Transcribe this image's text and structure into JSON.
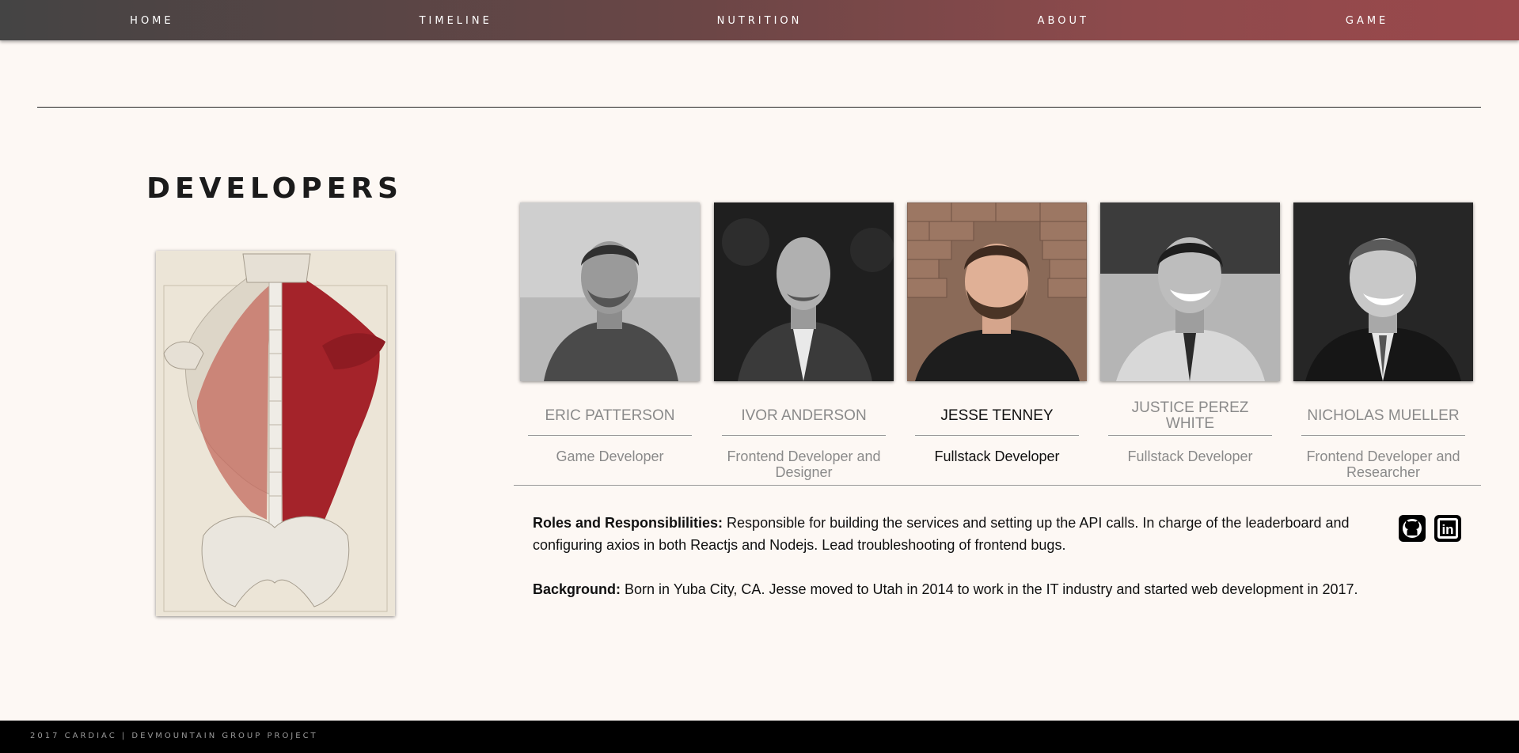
{
  "nav": {
    "items": [
      "HOME",
      "TIMELINE",
      "NUTRITION",
      "ABOUT",
      "GAME"
    ]
  },
  "page": {
    "title": "DEVELOPERS"
  },
  "developers": [
    {
      "name": "ERIC PATTERSON",
      "role": "Game Developer",
      "active": false
    },
    {
      "name": "IVOR ANDERSON",
      "role": "Frontend Developer and Designer",
      "active": false
    },
    {
      "name": "JESSE TENNEY",
      "role": "Fullstack Developer",
      "active": true
    },
    {
      "name": "JUSTICE PEREZ WHITE",
      "role": "Fullstack Developer",
      "active": false
    },
    {
      "name": "NICHOLAS MUELLER",
      "role": "Frontend Developer and Researcher",
      "active": false
    }
  ],
  "bio": {
    "roles_label": "Roles and Responsiblilities:",
    "roles_text": " Responsible for building the services and setting up the API calls. In charge of the leaderboard and configuring axios in both Reactjs and Nodejs. Lead troubleshooting of frontend bugs.",
    "background_label": "Background:",
    "background_text": " Born in Yuba City, CA. Jesse moved to Utah in 2014 to work in the IT industry and started web development in 2017."
  },
  "social": {
    "github_icon": "github-icon",
    "linkedin_icon": "linkedin-icon",
    "linkedin_glyph": "in"
  },
  "footer": {
    "text": "2017 CARDIAC | DEVMOUNTAIN GROUP PROJECT"
  },
  "colors": {
    "background": "#fdf8f4",
    "nav_start": "#444444",
    "nav_end": "#9a484b",
    "inactive_text": "#8a8a8a"
  }
}
